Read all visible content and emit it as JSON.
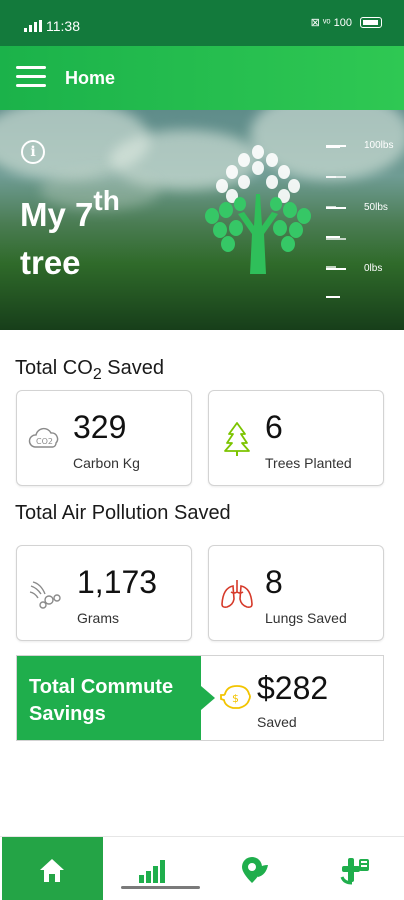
{
  "status_bar": {
    "time": "11:38",
    "right_text": "⊠ ᵛᵒ 100"
  },
  "app_bar": {
    "title": "Home"
  },
  "hero": {
    "title_prefix": "My 7",
    "title_suffix": "th",
    "title_line2": "tree",
    "scale_labels": [
      "100lbs",
      "50lbs",
      "0lbs"
    ]
  },
  "co2": {
    "title_prefix": "Total CO",
    "title_sub": "2",
    "title_suffix": " Saved",
    "cards": [
      {
        "value": "329",
        "label": "Carbon Kg",
        "icon": "co2-cloud-icon"
      },
      {
        "value": "6",
        "label": "Trees Planted",
        "icon": "pine-tree-icon"
      }
    ]
  },
  "pollution": {
    "title": "Total Air Pollution Saved",
    "cards": [
      {
        "value": "1,173",
        "label": "Grams",
        "icon": "exhaust-icon"
      },
      {
        "value": "8",
        "label": "Lungs Saved",
        "icon": "lungs-icon"
      }
    ]
  },
  "commute": {
    "title": "Total Commute Savings",
    "value": "$282",
    "label": "Saved",
    "icon": "piggy-bank-icon"
  },
  "bottom_nav": [
    {
      "icon": "home-icon",
      "active": true
    },
    {
      "icon": "bar-chart-icon",
      "active": false
    },
    {
      "icon": "map-pin-leaf-icon",
      "active": false
    },
    {
      "icon": "route-icon",
      "active": false
    }
  ],
  "colors": {
    "primary": "#1fae4c",
    "status_bar": "#137a3c",
    "accent_yellow": "#f2c400",
    "lungs_red": "#d63a2a",
    "tree_green": "#7cc400"
  }
}
